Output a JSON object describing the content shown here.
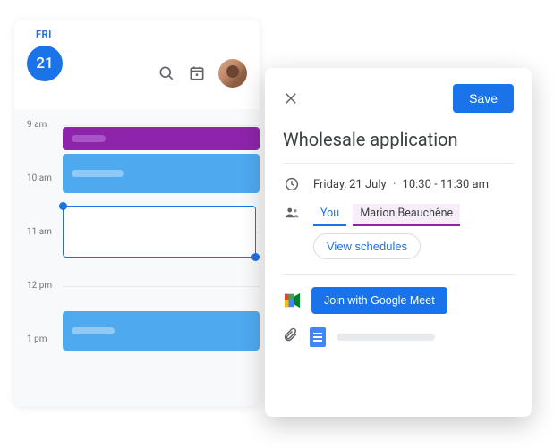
{
  "calendar": {
    "day_label": "FRI",
    "day_number": "21",
    "hours": [
      "9 am",
      "10 am",
      "11 am",
      "12 pm",
      "1 pm"
    ]
  },
  "details": {
    "save_label": "Save",
    "title": "Wholesale application",
    "date_text": "Friday, 21 July",
    "time_text": "10:30 - 11:30 am",
    "you_chip": "You",
    "guest_chip": "Marion Beauchêne",
    "view_schedules_label": "View schedules",
    "meet_label": "Join with Google Meet"
  }
}
